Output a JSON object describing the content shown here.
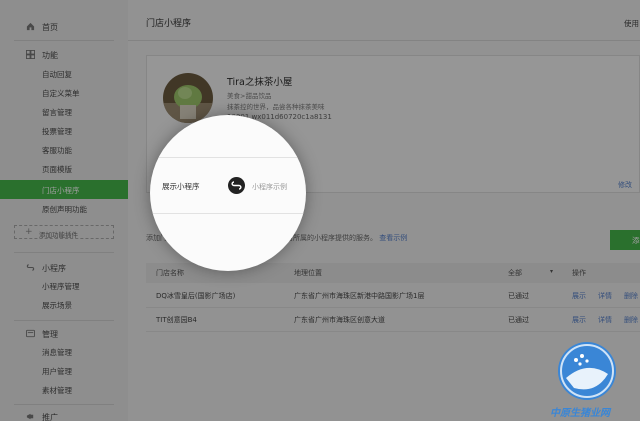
{
  "sidebar": {
    "home": {
      "label": "首页",
      "icon": "home-icon"
    },
    "features": {
      "label": "功能",
      "icon": "grid-icon",
      "items": [
        {
          "label": "自动回复"
        },
        {
          "label": "自定义菜单"
        },
        {
          "label": "留言管理"
        },
        {
          "label": "投票管理"
        },
        {
          "label": "客服功能"
        },
        {
          "label": "页面模版"
        },
        {
          "label": "门店小程序",
          "active": true
        },
        {
          "label": "原创声明功能"
        }
      ],
      "add_plugin": "添加功能插件"
    },
    "mini_program": {
      "label": "小程序",
      "icon": "mini-program-icon",
      "items": [
        {
          "label": "小程序管理"
        },
        {
          "label": "展示场景"
        }
      ]
    },
    "manage": {
      "label": "管理",
      "icon": "manage-icon",
      "items": [
        {
          "label": "消息管理"
        },
        {
          "label": "用户管理"
        },
        {
          "label": "素材管理"
        }
      ]
    },
    "promote": {
      "label": "推广",
      "icon": "megaphone-icon"
    }
  },
  "header": {
    "title": "门店小程序",
    "right_link": "使用"
  },
  "store": {
    "name": "Tira之抹茶小屋",
    "category": "美食>甜品饮品",
    "description": "抹茶控的世界，品尝各种抹茶美味",
    "id": "10001 wx011d60720c1a8131"
  },
  "showcase": {
    "label": "展示小程序",
    "placeholder": "小程序示例",
    "icon": "mini-program-icon"
  },
  "modify_link": "修改",
  "hint": {
    "text": "添加门店，用户将可在微信内更便捷地了解门店所属的小程序提供的服务。",
    "link": "查看示例"
  },
  "add_button": "添",
  "table": {
    "headers": [
      "门店名称",
      "地理位置",
      "全部",
      "操作"
    ],
    "rows": [
      {
        "name": "DQ冰雪皇后(国影广场店)",
        "location": "广东省广州市海珠区新港中路国影广场1层",
        "status": "已通过",
        "actions": [
          "展示",
          "详情",
          "删除"
        ]
      },
      {
        "name": "TIT创意园B4",
        "location": "广东省广州市海珠区创意大道",
        "status": "已通过",
        "actions": [
          "展示",
          "详情",
          "删除"
        ]
      }
    ]
  },
  "watermark": "中原生猪业网",
  "colors": {
    "accent": "#44b549",
    "link": "#557fc8"
  }
}
